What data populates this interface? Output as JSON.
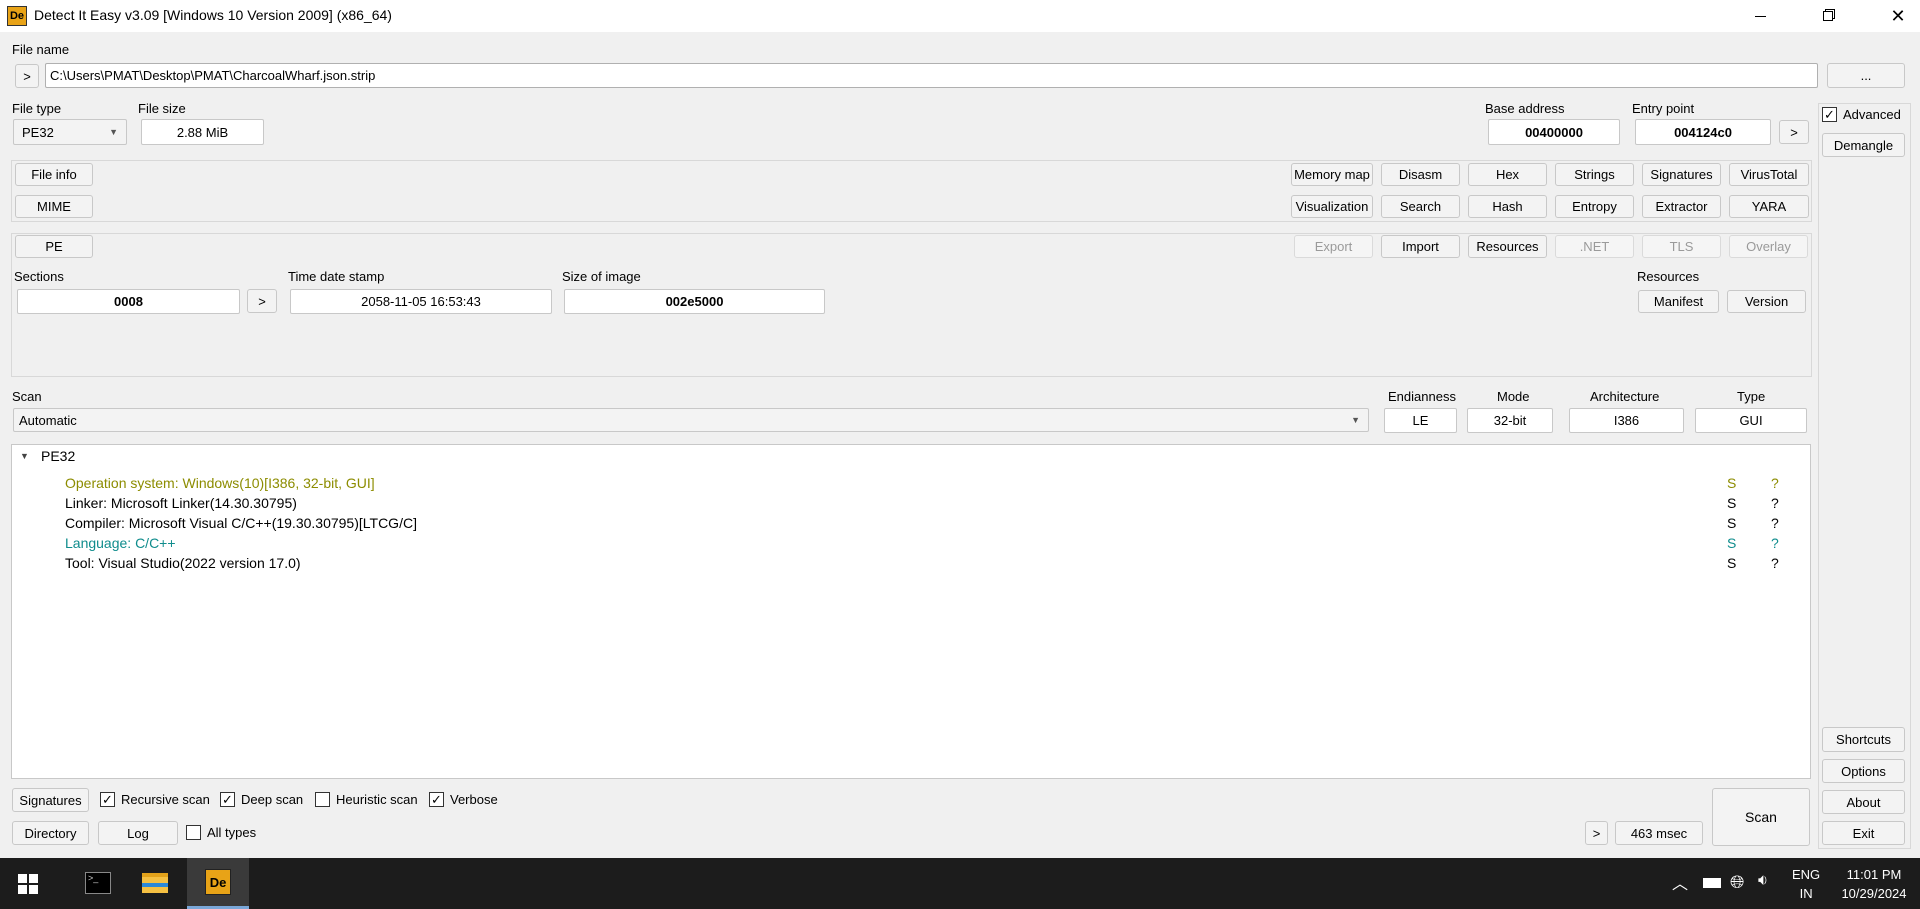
{
  "window": {
    "title": "Detect It Easy v3.09 [Windows 10 Version 2009] (x86_64)"
  },
  "file": {
    "name_label": "File name",
    "path": "C:\\Users\\PMAT\\Desktop\\PMAT\\CharcoalWharf.json.strip",
    "go": ">",
    "browse": "...",
    "type_label": "File type",
    "type": "PE32",
    "size_label": "File size",
    "size": "2.88 MiB"
  },
  "addr": {
    "base_label": "Base address",
    "base": "00400000",
    "entry_label": "Entry point",
    "entry": "004124c0",
    "go": ">"
  },
  "side": {
    "advanced": "Advanced",
    "advanced_checked": true,
    "demangle": "Demangle",
    "shortcuts": "Shortcuts",
    "options": "Options",
    "about": "About",
    "exit": "Exit"
  },
  "tools": {
    "file_info": "File info",
    "mime": "MIME",
    "row1": [
      "Memory map",
      "Disasm",
      "Hex",
      "Strings",
      "Signatures",
      "VirusTotal"
    ],
    "row2": [
      "Visualization",
      "Search",
      "Hash",
      "Entropy",
      "Extractor",
      "YARA"
    ]
  },
  "pe": {
    "button": "PE",
    "export": "Export",
    "import": "Import",
    "resources": "Resources",
    "net": ".NET",
    "tls": "TLS",
    "overlay": "Overlay",
    "sections_label": "Sections",
    "sections": "0008",
    "go": ">",
    "tds_label": "Time date stamp",
    "tds": "2058-11-05 16:53:43",
    "soi_label": "Size of image",
    "soi": "002e5000",
    "res_label": "Resources",
    "manifest": "Manifest",
    "version": "Version"
  },
  "scan": {
    "label": "Scan",
    "mode": "Automatic",
    "endianness_label": "Endianness",
    "endianness": "LE",
    "mode_label": "Mode",
    "bits": "32-bit",
    "arch_label": "Architecture",
    "arch": "I386",
    "type_label": "Type",
    "type": "GUI"
  },
  "results": {
    "root": "PE32",
    "items": [
      {
        "text": "Operation system: Windows(10)[I386, 32-bit, GUI]",
        "s": "S",
        "q": "?",
        "color": "#8c8c00"
      },
      {
        "text": "Linker: Microsoft Linker(14.30.30795)",
        "s": "S",
        "q": "?",
        "color": "#000000"
      },
      {
        "text": "Compiler: Microsoft Visual C/C++(19.30.30795)[LTCG/C]",
        "s": "S",
        "q": "?",
        "color": "#000000"
      },
      {
        "text": "Language: C/C++",
        "s": "S",
        "q": "?",
        "color": "#0f8c8c"
      },
      {
        "text": "Tool: Visual Studio(2022 version 17.0)",
        "s": "S",
        "q": "?",
        "color": "#000000"
      }
    ]
  },
  "bottom": {
    "signatures": "Signatures",
    "recursive": "Recursive scan",
    "deep": "Deep scan",
    "heuristic": "Heuristic scan",
    "verbose": "Verbose",
    "directory": "Directory",
    "log": "Log",
    "all_types": "All types",
    "go": ">",
    "time": "463 msec",
    "scan": "Scan"
  },
  "taskbar": {
    "lang1": "ENG",
    "lang2": "IN",
    "time": "11:01 PM",
    "date": "10/29/2024"
  }
}
